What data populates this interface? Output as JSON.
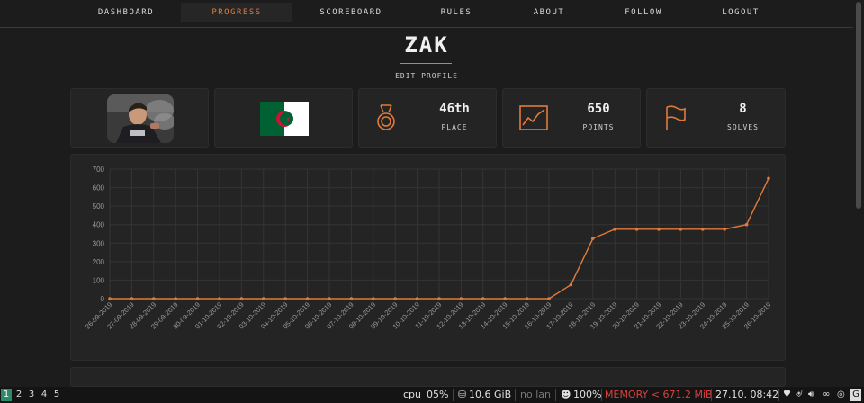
{
  "nav": {
    "items": [
      "DASHBOARD",
      "PROGRESS",
      "SCOREBOARD",
      "RULES",
      "ABOUT",
      "FOLLOW",
      "LOGOUT"
    ],
    "active": "PROGRESS"
  },
  "profile": {
    "username": "ZAK",
    "edit_label": "EDIT PROFILE"
  },
  "stats": {
    "place": {
      "value": "46th",
      "label": "PLACE",
      "icon": "medal-icon"
    },
    "points": {
      "value": "650",
      "label": "POINTS",
      "icon": "chart-icon"
    },
    "solves": {
      "value": "8",
      "label": "SOLVES",
      "icon": "flag-icon"
    }
  },
  "colors": {
    "accent": "#e07a3a",
    "flag_green": "#006233",
    "flag_red": "#d21034"
  },
  "chart_data": {
    "type": "line",
    "x": [
      "26-09-2019",
      "27-09-2019",
      "28-09-2019",
      "29-09-2019",
      "30-09-2019",
      "01-10-2019",
      "02-10-2019",
      "03-10-2019",
      "04-10-2019",
      "05-10-2019",
      "06-10-2019",
      "07-10-2019",
      "08-10-2019",
      "09-10-2019",
      "10-10-2019",
      "11-10-2019",
      "12-10-2019",
      "13-10-2019",
      "14-10-2019",
      "15-10-2019",
      "16-10-2019",
      "17-10-2019",
      "18-10-2019",
      "19-10-2019",
      "20-10-2019",
      "21-10-2019",
      "22-10-2019",
      "23-10-2019",
      "24-10-2019",
      "25-10-2019",
      "26-10-2019"
    ],
    "series": [
      {
        "values": [
          0,
          0,
          0,
          0,
          0,
          0,
          0,
          0,
          0,
          0,
          0,
          0,
          0,
          0,
          0,
          0,
          0,
          0,
          0,
          0,
          0,
          75,
          325,
          375,
          375,
          375,
          375,
          375,
          375,
          400,
          650
        ]
      }
    ],
    "yticks": [
      0,
      100,
      200,
      300,
      400,
      500,
      600,
      700
    ],
    "ylim": [
      0,
      700
    ],
    "grid": true,
    "color": "#e07a3a"
  },
  "taskbar": {
    "workspaces": [
      "1",
      "2",
      "3",
      "4",
      "5"
    ],
    "active_workspace": "1",
    "cpu_label": "cpu",
    "cpu_value": "05%",
    "disk": "10.6 GiB",
    "lan": "no lan",
    "battery": "100%",
    "memory": "MEMORY < 671.2 MiB",
    "datetime": "27.10. 08:42"
  }
}
